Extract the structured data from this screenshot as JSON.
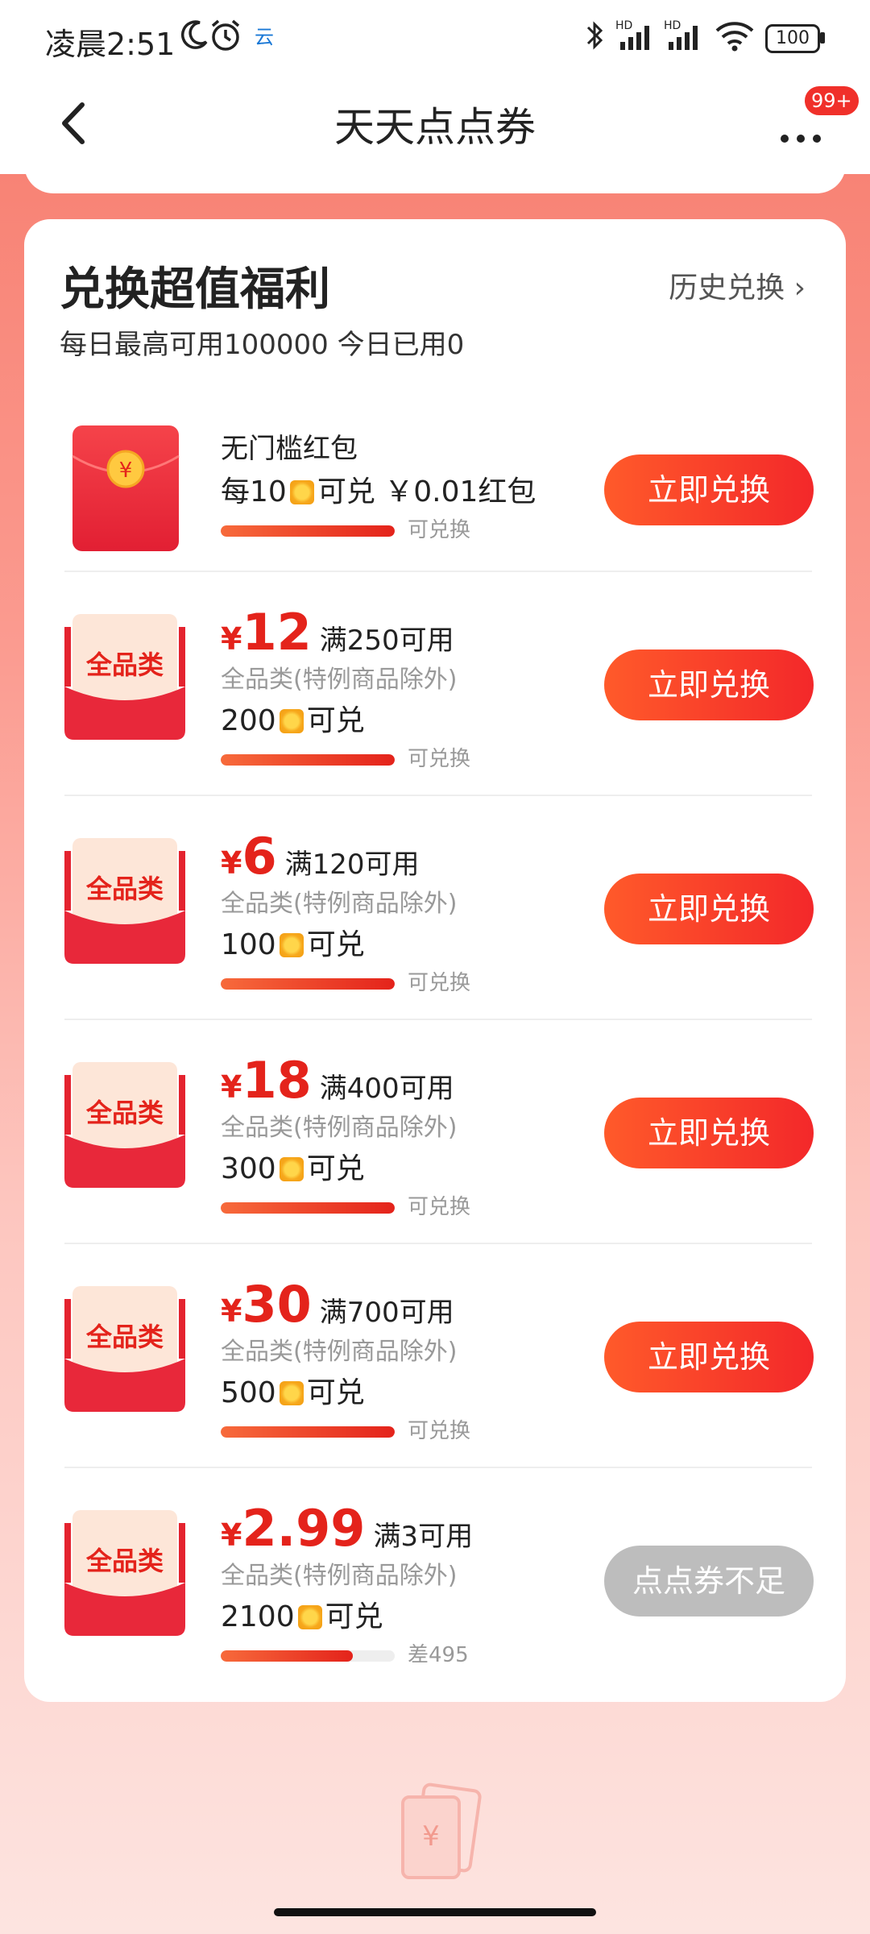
{
  "status_bar": {
    "time": "凌晨2:51",
    "signal1": "HD",
    "signal2": "HD",
    "battery": "100"
  },
  "nav": {
    "title": "天天点点券",
    "badge": "99+"
  },
  "section": {
    "title": "兑换超值福利",
    "history_label": "历史兑换 ›",
    "quota_text": "每日最高可用100000 今日已用0"
  },
  "items": [
    {
      "type": "redpacket",
      "name": "无门槛红包",
      "cost_prefix": "每10",
      "cost_suffix": "可兑 ￥0.01红包",
      "progress": 1.0,
      "progress_label": "可兑换",
      "button": "立即兑换",
      "enabled": true
    },
    {
      "type": "coupon",
      "icon_text": "全品类",
      "yen": "¥",
      "amount": "12",
      "condition": "满250可用",
      "scope": "全品类(特例商品除外)",
      "cost": "200",
      "cost_suffix": "可兑",
      "progress": 1.0,
      "progress_label": "可兑换",
      "button": "立即兑换",
      "enabled": true
    },
    {
      "type": "coupon",
      "icon_text": "全品类",
      "yen": "¥",
      "amount": "6",
      "condition": "满120可用",
      "scope": "全品类(特例商品除外)",
      "cost": "100",
      "cost_suffix": "可兑",
      "progress": 1.0,
      "progress_label": "可兑换",
      "button": "立即兑换",
      "enabled": true
    },
    {
      "type": "coupon",
      "icon_text": "全品类",
      "yen": "¥",
      "amount": "18",
      "condition": "满400可用",
      "scope": "全品类(特例商品除外)",
      "cost": "300",
      "cost_suffix": "可兑",
      "progress": 1.0,
      "progress_label": "可兑换",
      "button": "立即兑换",
      "enabled": true
    },
    {
      "type": "coupon",
      "icon_text": "全品类",
      "yen": "¥",
      "amount": "30",
      "condition": "满700可用",
      "scope": "全品类(特例商品除外)",
      "cost": "500",
      "cost_suffix": "可兑",
      "progress": 1.0,
      "progress_label": "可兑换",
      "button": "立即兑换",
      "enabled": true
    },
    {
      "type": "coupon",
      "icon_text": "全品类",
      "yen": "¥",
      "amount": "2.99",
      "condition": "满3可用",
      "scope": "全品类(特例商品除外)",
      "cost": "2100",
      "cost_suffix": "可兑",
      "progress": 0.76,
      "progress_label": "差495",
      "button": "点点券不足",
      "enabled": false
    }
  ],
  "colors": {
    "accent": "#e4231b",
    "button": "#f3282a",
    "disabled": "#bdbdbd"
  }
}
